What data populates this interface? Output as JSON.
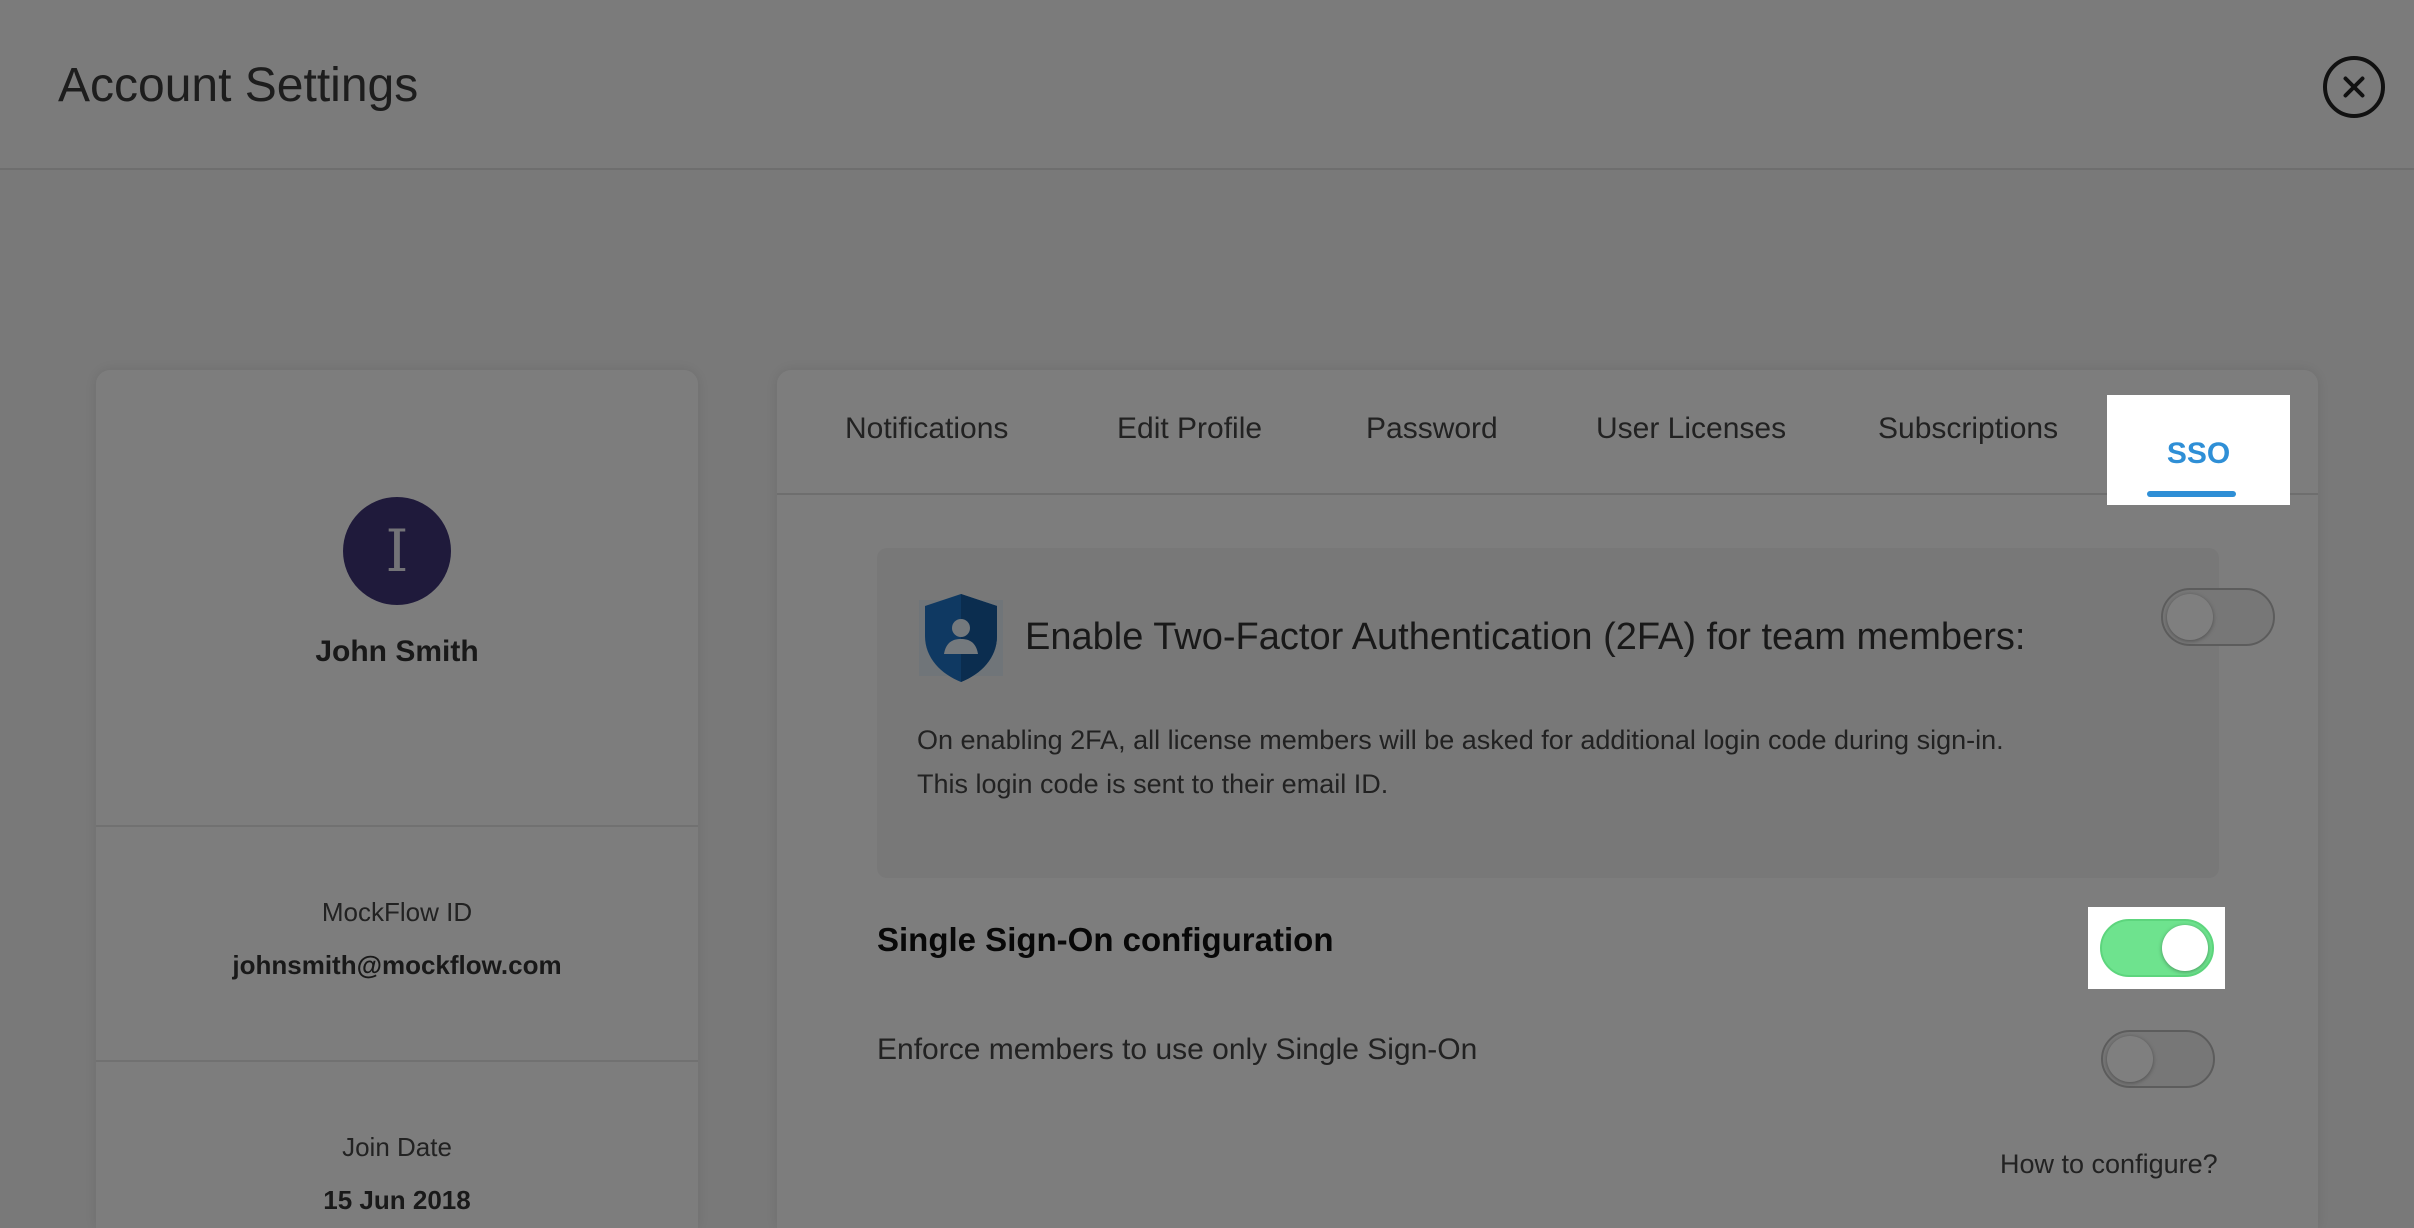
{
  "header": {
    "title": "Account Settings"
  },
  "profile": {
    "avatar_initial": "I",
    "name": "John Smith",
    "mockflow_id_label": "MockFlow ID",
    "mockflow_id": "johnsmith@mockflow.com",
    "join_date_label": "Join Date",
    "join_date": "15 Jun 2018"
  },
  "tabs": [
    {
      "label": "Notifications"
    },
    {
      "label": "Edit Profile"
    },
    {
      "label": "Password"
    },
    {
      "label": "User Licenses"
    },
    {
      "label": "Subscriptions"
    },
    {
      "label": "SSO",
      "active": true
    }
  ],
  "twofa": {
    "title": "Enable Two-Factor Authentication (2FA) for team members:",
    "description_line1": "On enabling 2FA, all license members will be asked for additional login code during sign-in.",
    "description_line2": "This login code is sent to their email ID.",
    "enabled": false
  },
  "sso": {
    "title": "Single Sign-On configuration",
    "enabled": true,
    "enforce_label": "Enforce members to use only Single Sign-On",
    "enforce_enabled": false,
    "how_to_link": "How to configure?"
  },
  "colors": {
    "accent": "#2f8fd6",
    "toggle_on": "#6ee38e",
    "avatar_bg": "#3f3577",
    "overlay": "rgba(0,0,0,0.5)"
  },
  "icons": {
    "close": "close-icon",
    "shield": "shield-user-icon"
  }
}
